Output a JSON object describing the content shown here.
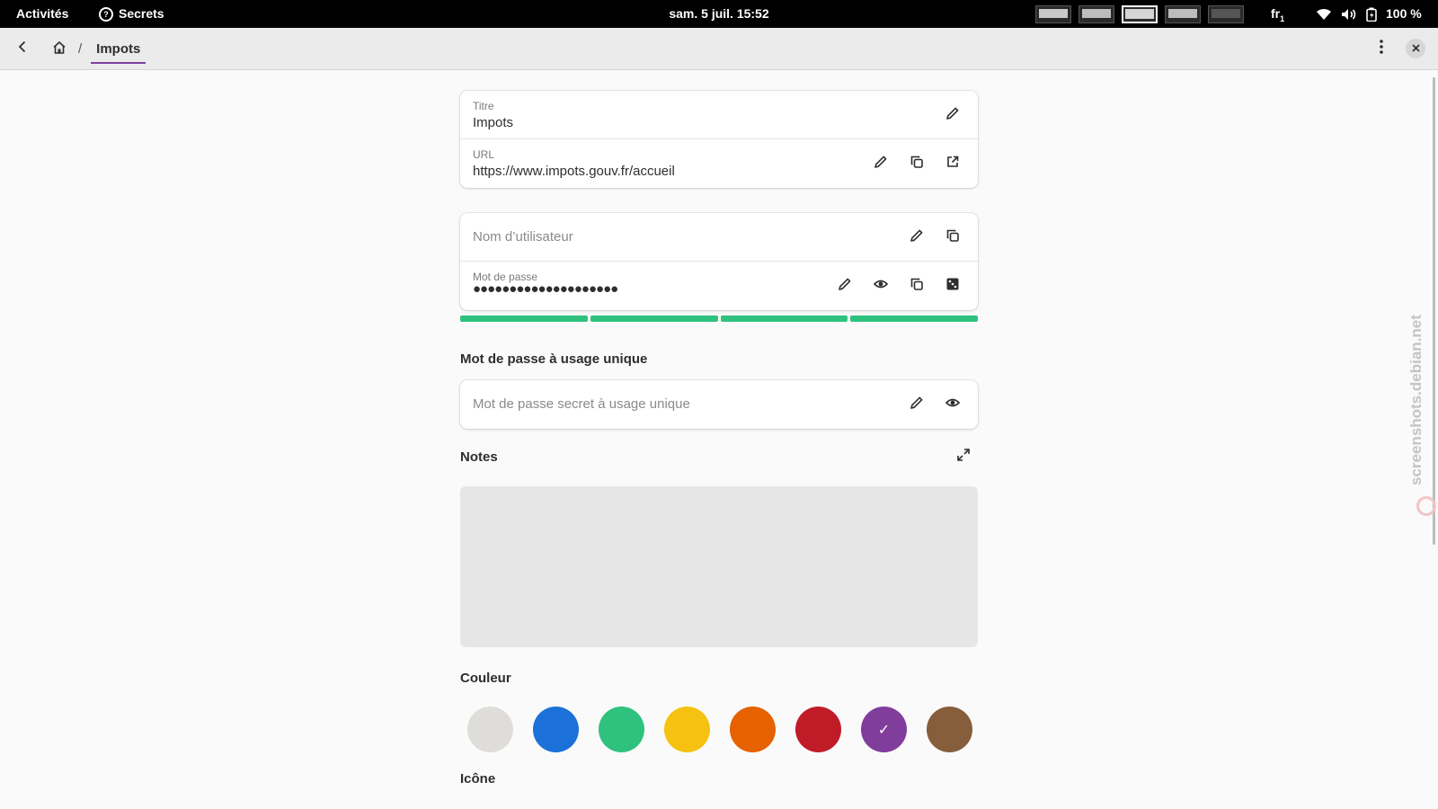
{
  "topbar": {
    "activities": "Activités",
    "app_name": "Secrets",
    "app_icon": "?",
    "clock": "sam. 5 juil.  15:52",
    "keyboard_layout": "fr",
    "keyboard_layout_sub": "1",
    "battery": "100 %"
  },
  "header": {
    "breadcrumb_current": "Impots",
    "breadcrumb_separator": "/"
  },
  "general": {
    "title_label": "Titre",
    "title_value": "Impots",
    "url_label": "URL",
    "url_value": "https://www.impots.gouv.fr/accueil"
  },
  "credentials": {
    "username_placeholder": "Nom d’utilisateur",
    "password_label": "Mot de passe",
    "password_masked": "●●●●●●●●●●●●●●●●●●●●",
    "strength_segments_filled": 4,
    "strength_segments_total": 4,
    "strength_color": "#2ec27e"
  },
  "otp": {
    "heading": "Mot de passe à usage unique",
    "placeholder": "Mot de passe secret à usage unique"
  },
  "notes": {
    "heading": "Notes",
    "content": ""
  },
  "color": {
    "heading": "Couleur",
    "selected_index": 6,
    "check_mark": "✓",
    "swatches": [
      "#deddda",
      "#1c71d8",
      "#2ec27e",
      "#f5c211",
      "#e66100",
      "#c01c28",
      "#813d9c",
      "#865e3c"
    ]
  },
  "icon_section": {
    "heading": "Icône"
  },
  "watermark": "screenshots.debian.net"
}
